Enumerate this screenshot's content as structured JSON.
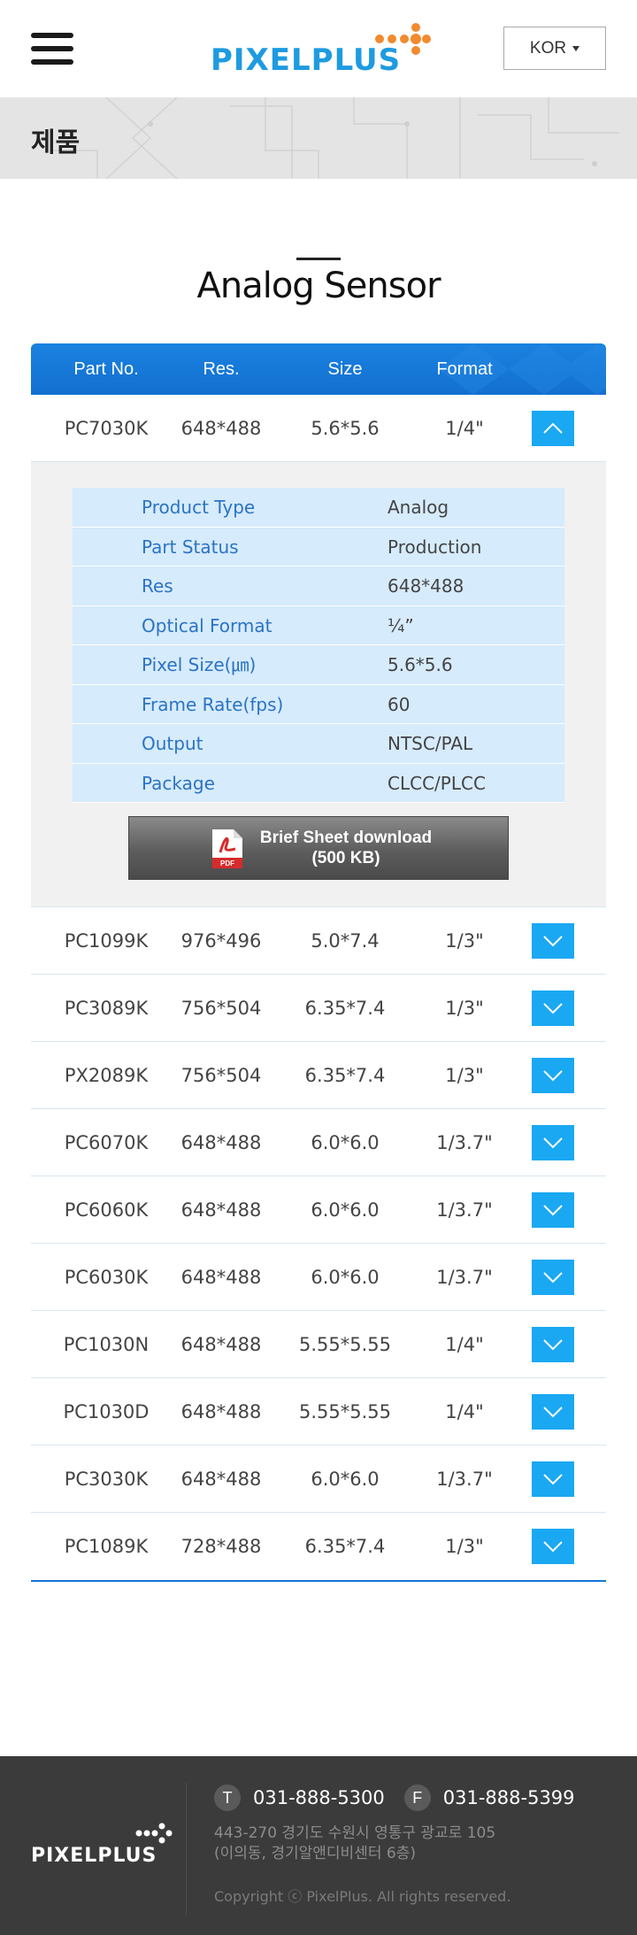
{
  "header": {
    "logo_text": "PIXELPLUS",
    "language": "KOR",
    "colors": {
      "logo_blue": "#1e9be0",
      "logo_orange": "#f28a2e"
    }
  },
  "subbanner": {
    "title": "제품"
  },
  "section": {
    "title": "Analog Sensor"
  },
  "table": {
    "headers": [
      "Part No.",
      "Res.",
      "Size",
      "Format"
    ],
    "accent_color": "#1476d2",
    "expanded_row": {
      "part": "PC7030K",
      "res": "648*488",
      "size": "5.6*5.6",
      "format": "1/4\"",
      "toggle_icon": "chevron-up-icon",
      "specs": [
        {
          "key": "Product Type",
          "value": "Analog"
        },
        {
          "key": "Part Status",
          "value": "Production"
        },
        {
          "key": "Res",
          "value": "648*488"
        },
        {
          "key": "Optical Format",
          "value": "¼”"
        },
        {
          "key": "Pixel Size(㎛)",
          "value": "5.6*5.6"
        },
        {
          "key": "Frame Rate(fps)",
          "value": "60"
        },
        {
          "key": "Output",
          "value": "NTSC/PAL"
        },
        {
          "key": "Package",
          "value": "CLCC/PLCC"
        }
      ],
      "download": {
        "line1": "Brief Sheet download",
        "line2": "(500 KB)",
        "icon": "pdf-icon"
      }
    },
    "rows": [
      {
        "part": "PC1099K",
        "res": "976*496",
        "size": "5.0*7.4",
        "format": "1/3\""
      },
      {
        "part": "PC3089K",
        "res": "756*504",
        "size": "6.35*7.4",
        "format": "1/3\""
      },
      {
        "part": "PX2089K",
        "res": "756*504",
        "size": "6.35*7.4",
        "format": "1/3\""
      },
      {
        "part": "PC6070K",
        "res": "648*488",
        "size": "6.0*6.0",
        "format": "1/3.7\""
      },
      {
        "part": "PC6060K",
        "res": "648*488",
        "size": "6.0*6.0",
        "format": "1/3.7\""
      },
      {
        "part": "PC6030K",
        "res": "648*488",
        "size": "6.0*6.0",
        "format": "1/3.7\""
      },
      {
        "part": "PC1030N",
        "res": "648*488",
        "size": "5.55*5.55",
        "format": "1/4\""
      },
      {
        "part": "PC1030D",
        "res": "648*488",
        "size": "5.55*5.55",
        "format": "1/4\""
      },
      {
        "part": "PC3030K",
        "res": "648*488",
        "size": "6.0*6.0",
        "format": "1/3.7\""
      },
      {
        "part": "PC1089K",
        "res": "728*488",
        "size": "6.35*7.4",
        "format": "1/3\""
      }
    ]
  },
  "footer": {
    "logo_text": "PIXELPLUS",
    "tel_label": "T",
    "tel": "031-888-5300",
    "fax_label": "F",
    "fax": "031-888-5399",
    "address_line1": "443-270 경기도 수원시 영통구 광교로 105",
    "address_line2": "(이의동, 경기알앤디비센터 6층)",
    "copyright": "Copyright ⓒ PixelPlus. All rights reserved."
  }
}
